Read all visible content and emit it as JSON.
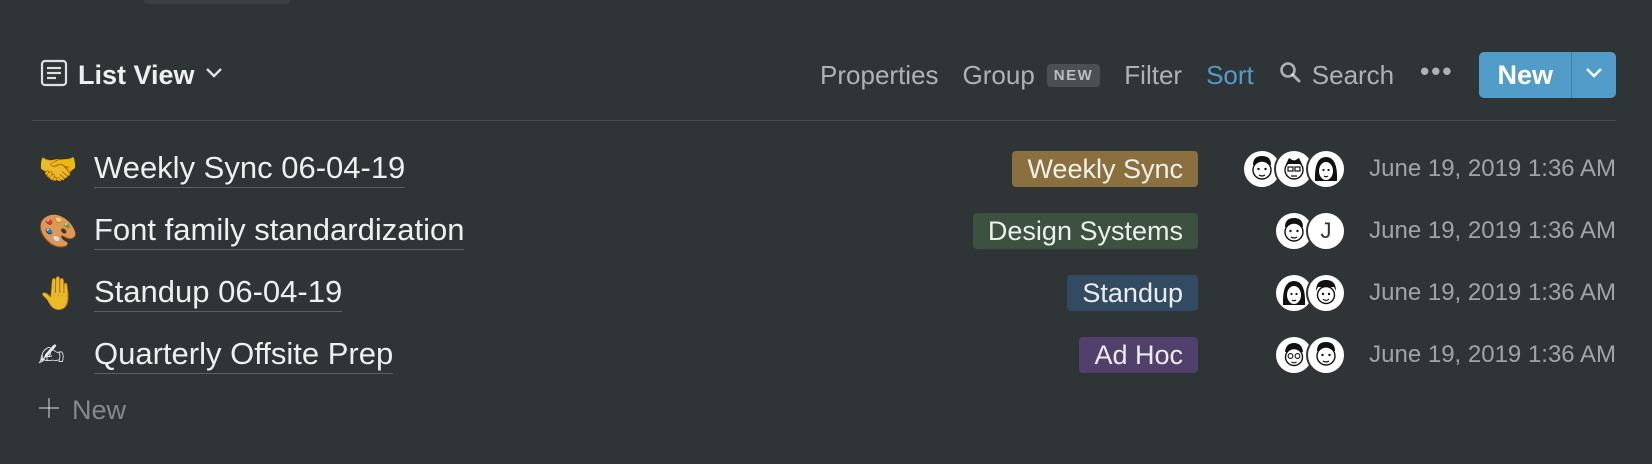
{
  "toolbar": {
    "view_label": "List View",
    "properties_label": "Properties",
    "group_label": "Group",
    "group_badge": "NEW",
    "filter_label": "Filter",
    "sort_label": "Sort",
    "search_label": "Search",
    "more_label": "•••",
    "new_label": "New"
  },
  "rows": [
    {
      "emoji": "🤝",
      "title": "Weekly Sync 06-04-19",
      "tag": "Weekly Sync",
      "tag_color": "#89703e",
      "people": [
        "face-a",
        "face-b",
        "face-c"
      ],
      "date": "June 19, 2019 1:36 AM"
    },
    {
      "emoji": "🎨",
      "title": "Font family standardization",
      "tag": "Design Systems",
      "tag_color": "#3c5140",
      "people": [
        "face-a",
        "J"
      ],
      "date": "June 19, 2019 1:36 AM"
    },
    {
      "emoji": "🤚",
      "title": "Standup 06-04-19",
      "tag": "Standup",
      "tag_color": "#334a63",
      "people": [
        "face-c",
        "face-d"
      ],
      "date": "June 19, 2019 1:36 AM"
    },
    {
      "emoji": "✍",
      "title": "Quarterly Offsite Prep",
      "tag": "Ad Hoc",
      "tag_color": "#50406b",
      "people": [
        "face-e",
        "face-a"
      ],
      "date": "June 19, 2019 1:36 AM"
    }
  ],
  "add_new_label": "New",
  "colors": {
    "accent": "#529cca",
    "background": "#2f3437"
  }
}
